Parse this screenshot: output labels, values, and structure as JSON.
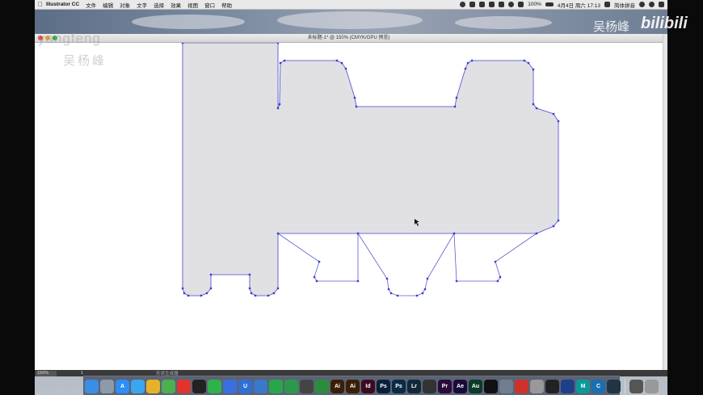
{
  "menubar": {
    "app_name": "Illustrator CC",
    "items": [
      "文件",
      "编辑",
      "对象",
      "文字",
      "选择",
      "效果",
      "视图",
      "窗口",
      "帮助"
    ],
    "battery": "100%",
    "clock": "4月4日 周六 17:13",
    "input_method": "简体拼音"
  },
  "window": {
    "title": "未标题-1* @ 150% (CMYK/GPU 预览)"
  },
  "status": {
    "zoom": "150%",
    "page": "1",
    "tool_hint": "形状生成器"
  },
  "watermark": {
    "top_left": "yangfeng",
    "top_left_cn": "吴杨峰",
    "top_right": "吴杨峰",
    "logo": "bilibili"
  },
  "dock": {
    "apps": [
      {
        "name": "Finder",
        "label": "",
        "color": "#3a8ee6"
      },
      {
        "name": "Launchpad",
        "label": "",
        "color": "#8e9aa8"
      },
      {
        "name": "App Store",
        "label": "A",
        "color": "#2d8ef5"
      },
      {
        "name": "Safari",
        "label": "",
        "color": "#3aa6f0"
      },
      {
        "name": "Chrome",
        "label": "",
        "color": "#e5b22a"
      },
      {
        "name": "Maps",
        "label": "",
        "color": "#4caf50"
      },
      {
        "name": "Weibo",
        "label": "",
        "color": "#e0342d"
      },
      {
        "name": "QQ",
        "label": "",
        "color": "#222"
      },
      {
        "name": "WeChat",
        "label": "",
        "color": "#2fb24c"
      },
      {
        "name": "Baidu",
        "label": "",
        "color": "#3b6fe0"
      },
      {
        "name": "U",
        "label": "U",
        "color": "#2f6fd6"
      },
      {
        "name": "Chain",
        "label": "",
        "color": "#3a78c9"
      },
      {
        "name": "Evernote",
        "label": "",
        "color": "#2aa64a"
      },
      {
        "name": "Green",
        "label": "",
        "color": "#2a9a4a"
      },
      {
        "name": "Draw",
        "label": "",
        "color": "#444"
      },
      {
        "name": "Pen",
        "label": "",
        "color": "#2a8d3a"
      },
      {
        "name": "Illustrator",
        "label": "Ai",
        "color": "#3a1e05"
      },
      {
        "name": "Illustrator 2",
        "label": "Ai",
        "color": "#3a1e05"
      },
      {
        "name": "InDesign",
        "label": "Id",
        "color": "#3d0a1f"
      },
      {
        "name": "Photoshop",
        "label": "Ps",
        "color": "#0a1f3a"
      },
      {
        "name": "Photoshop 2",
        "label": "Ps",
        "color": "#0a2a45"
      },
      {
        "name": "Lightroom",
        "label": "Lr",
        "color": "#10283a"
      },
      {
        "name": "Final Cut",
        "label": "",
        "color": "#333"
      },
      {
        "name": "Premiere",
        "label": "Pr",
        "color": "#2a0a3a"
      },
      {
        "name": "After Effects",
        "label": "Ae",
        "color": "#1a0a3a"
      },
      {
        "name": "Audition",
        "label": "Au",
        "color": "#0a3a2a"
      },
      {
        "name": "Camera",
        "label": "",
        "color": "#111"
      },
      {
        "name": "Settings",
        "label": "",
        "color": "#6f7f8f"
      },
      {
        "name": "Red",
        "label": "",
        "color": "#d0302a"
      },
      {
        "name": "Zbrush",
        "label": "",
        "color": "#999"
      },
      {
        "name": "Cinema",
        "label": "",
        "color": "#222"
      },
      {
        "name": "Blender",
        "label": "",
        "color": "#1e3f8a"
      },
      {
        "name": "Maya",
        "label": "M",
        "color": "#0a9a9a"
      },
      {
        "name": "C4D",
        "label": "C",
        "color": "#1a6fb0"
      },
      {
        "name": "Dark",
        "label": "",
        "color": "#234"
      }
    ],
    "tail": [
      {
        "name": "Downloads",
        "label": "",
        "color": "#555"
      },
      {
        "name": "Trash",
        "label": "",
        "color": "#999"
      }
    ]
  },
  "canvas": {
    "fill": "#dcdcdf",
    "stroke": "#5b5bd6",
    "anchor_color": "#3a3ad0"
  }
}
